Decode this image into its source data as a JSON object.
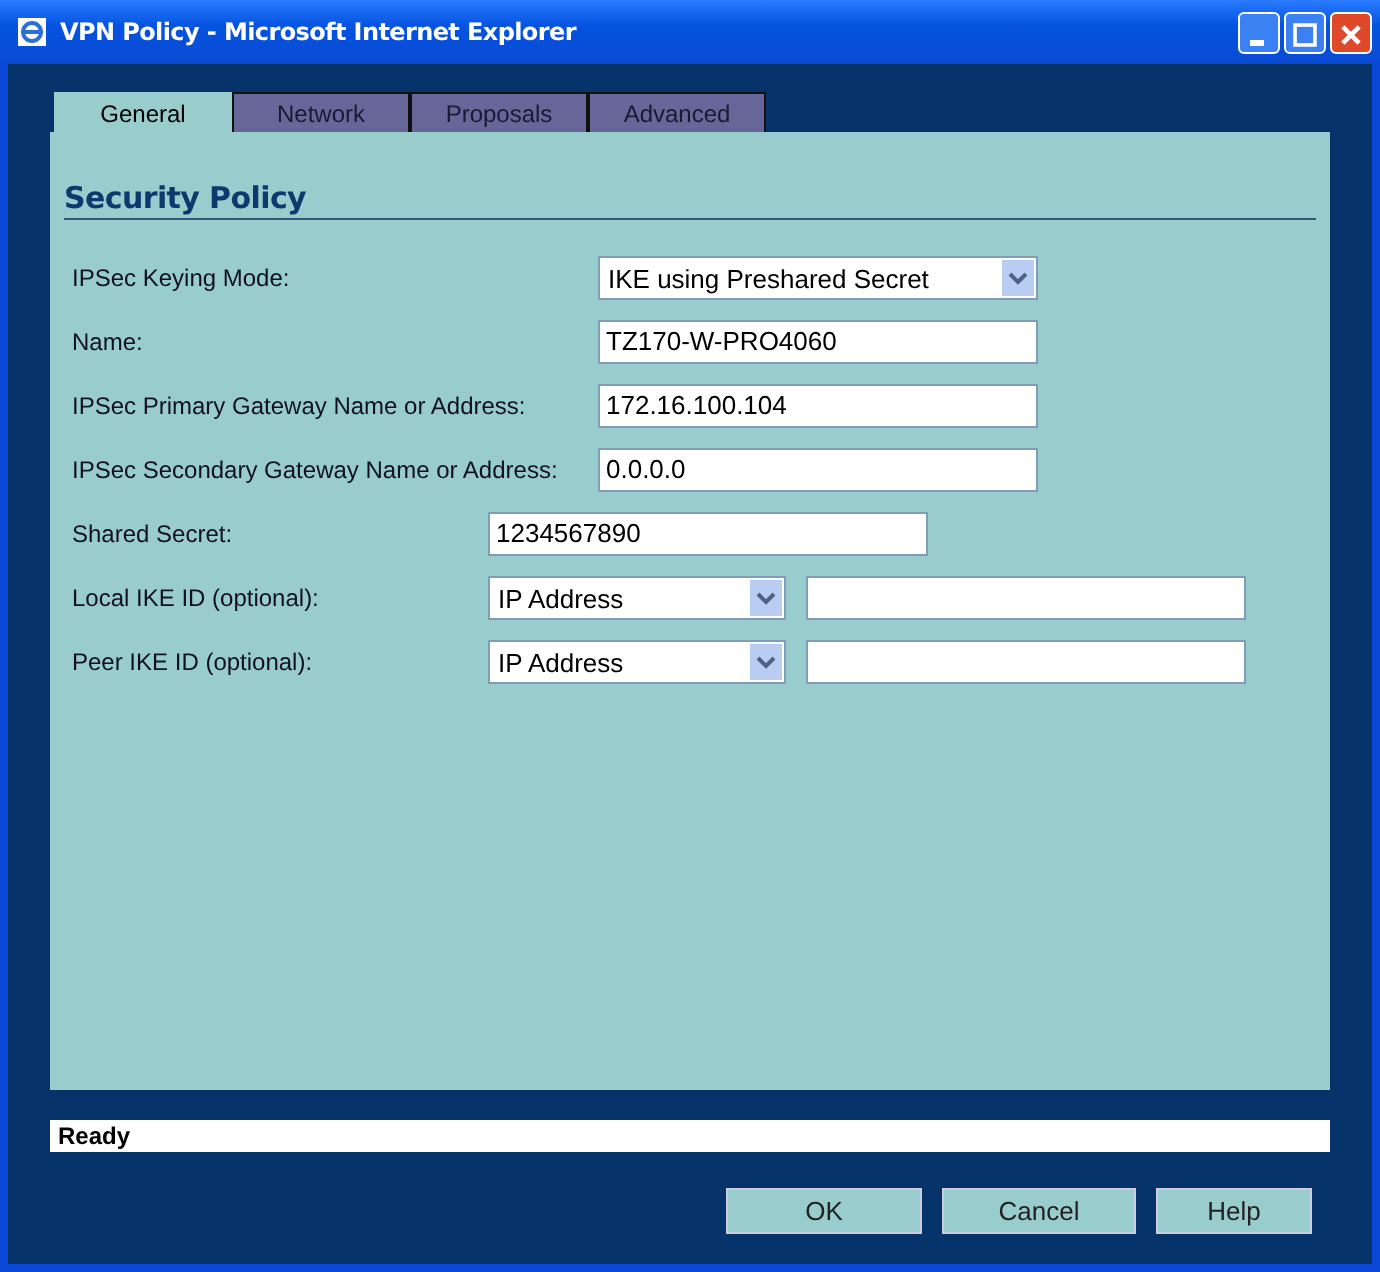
{
  "window": {
    "title": "VPN Policy - Microsoft Internet Explorer"
  },
  "tabs": [
    {
      "label": "General",
      "selected": true
    },
    {
      "label": "Network",
      "selected": false
    },
    {
      "label": "Proposals",
      "selected": false
    },
    {
      "label": "Advanced",
      "selected": false
    }
  ],
  "section_title": "Security Policy",
  "gateway_fields": [
    {
      "label": "IPSec Keying Mode:",
      "kind": "select",
      "value": "IKE using Preshared Secret"
    },
    {
      "label": "Name:",
      "kind": "text",
      "value": "TZ170-W-PRO4060"
    },
    {
      "label": "IPSec Primary Gateway Name or Address:",
      "kind": "text",
      "value": "172.16.100.104"
    },
    {
      "label": "IPSec Secondary Gateway Name or Address:",
      "kind": "text",
      "value": "0.0.0.0"
    }
  ],
  "id_fields": [
    {
      "label": "Shared Secret:",
      "kind": "text",
      "value": "1234567890"
    },
    {
      "label": "Local IKE ID (optional):",
      "kind": "select_input",
      "value": "IP Address"
    },
    {
      "label": "Peer IKE ID (optional):",
      "kind": "select_input",
      "value": "IP Address"
    }
  ],
  "status_bar": "Ready",
  "buttons": [
    "OK",
    "Cancel",
    "Help"
  ]
}
